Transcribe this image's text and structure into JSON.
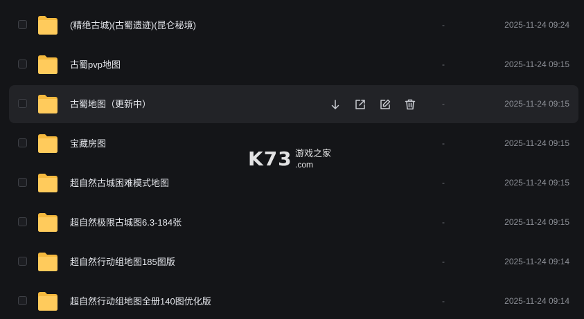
{
  "files": [
    {
      "name": "(精绝古城)(古蜀遗迹)(昆仑秘境)",
      "size": "-",
      "modified": "2025-11-24 09:24",
      "icon": "folder-icon"
    },
    {
      "name": "古蜀pvp地图",
      "size": "-",
      "modified": "2025-11-24 09:15",
      "icon": "folder-icon"
    },
    {
      "name": "古蜀地图（更新中）",
      "size": "-",
      "modified": "2025-11-24 09:15",
      "icon": "folder-icon",
      "hovered": true
    },
    {
      "name": "宝藏房图",
      "size": "-",
      "modified": "2025-11-24 09:15",
      "icon": "folder-icon"
    },
    {
      "name": "超自然古城困难模式地图",
      "size": "-",
      "modified": "2025-11-24 09:15",
      "icon": "folder-icon"
    },
    {
      "name": "超自然极限古城图6.3-184张",
      "size": "-",
      "modified": "2025-11-24 09:15",
      "icon": "folder-icon"
    },
    {
      "name": "超自然行动组地图185图版",
      "size": "-",
      "modified": "2025-11-24 09:14",
      "icon": "folder-icon"
    },
    {
      "name": "超自然行动组地图全册140图优化版",
      "size": "-",
      "modified": "2025-11-24 09:14",
      "icon": "folder-icon"
    }
  ],
  "row_actions": [
    {
      "icon": "download-icon"
    },
    {
      "icon": "share-icon"
    },
    {
      "icon": "edit-icon"
    },
    {
      "icon": "delete-icon"
    }
  ],
  "watermark": {
    "logo": "K73",
    "text": "游戏之家",
    "domain": ".com"
  },
  "colors": {
    "background": "#141518",
    "row_hover": "#222327",
    "folder": "#FFC857",
    "text_primary": "#e4e6eb",
    "text_secondary": "#8c8f96"
  }
}
